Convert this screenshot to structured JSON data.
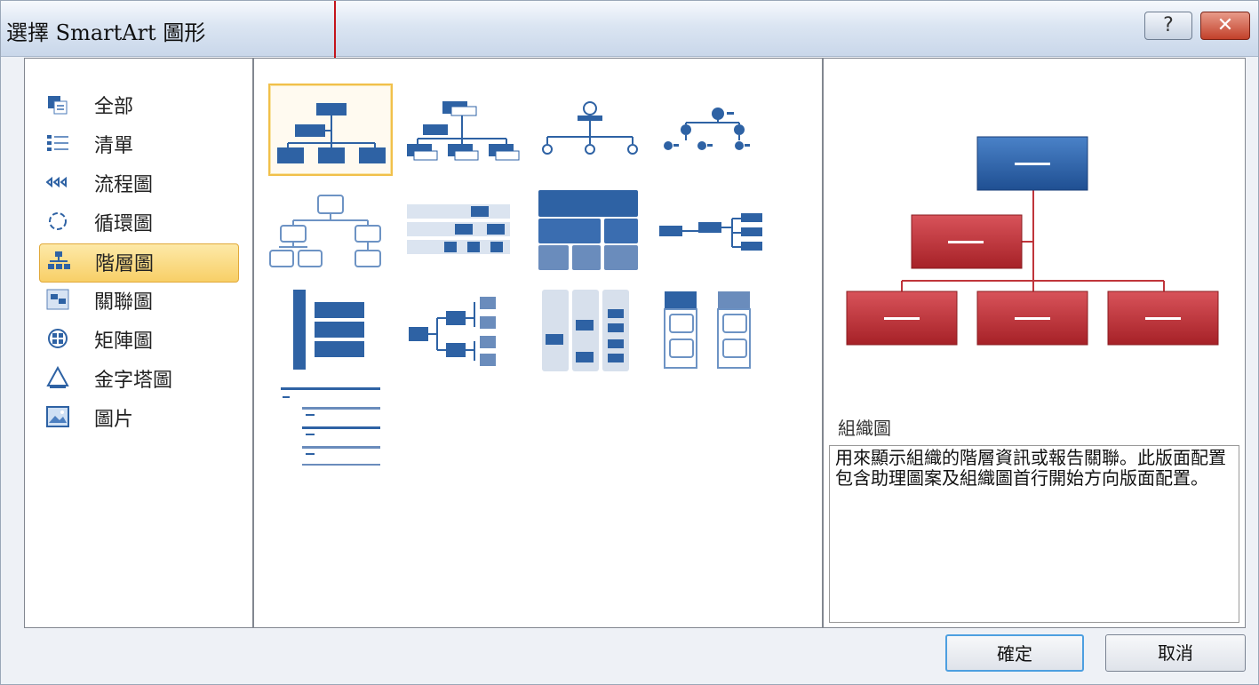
{
  "window": {
    "title": "選擇 SmartArt 圖形",
    "help_label": "?",
    "close_label": "✕"
  },
  "categories": [
    {
      "label": "全部",
      "icon": "all-icon"
    },
    {
      "label": "清單",
      "icon": "list-icon"
    },
    {
      "label": "流程圖",
      "icon": "process-icon"
    },
    {
      "label": "循環圖",
      "icon": "cycle-icon"
    },
    {
      "label": "階層圖",
      "icon": "hierarchy-icon",
      "selected": true
    },
    {
      "label": "關聯圖",
      "icon": "relationship-icon"
    },
    {
      "label": "矩陣圖",
      "icon": "matrix-icon"
    },
    {
      "label": "金字塔圖",
      "icon": "pyramid-icon"
    },
    {
      "label": "圖片",
      "icon": "picture-icon"
    }
  ],
  "preview": {
    "name": "組織圖",
    "description": "用來顯示組織的階層資訊或報告關聯。此版面配置包含助理圖案及組織圖首行開始方向版面配置。"
  },
  "buttons": {
    "ok": "確定",
    "cancel": "取消"
  },
  "colors": {
    "accent_blue": "#2e62a4",
    "accent_red": "#c0353b",
    "selection": "#f8cf67"
  }
}
